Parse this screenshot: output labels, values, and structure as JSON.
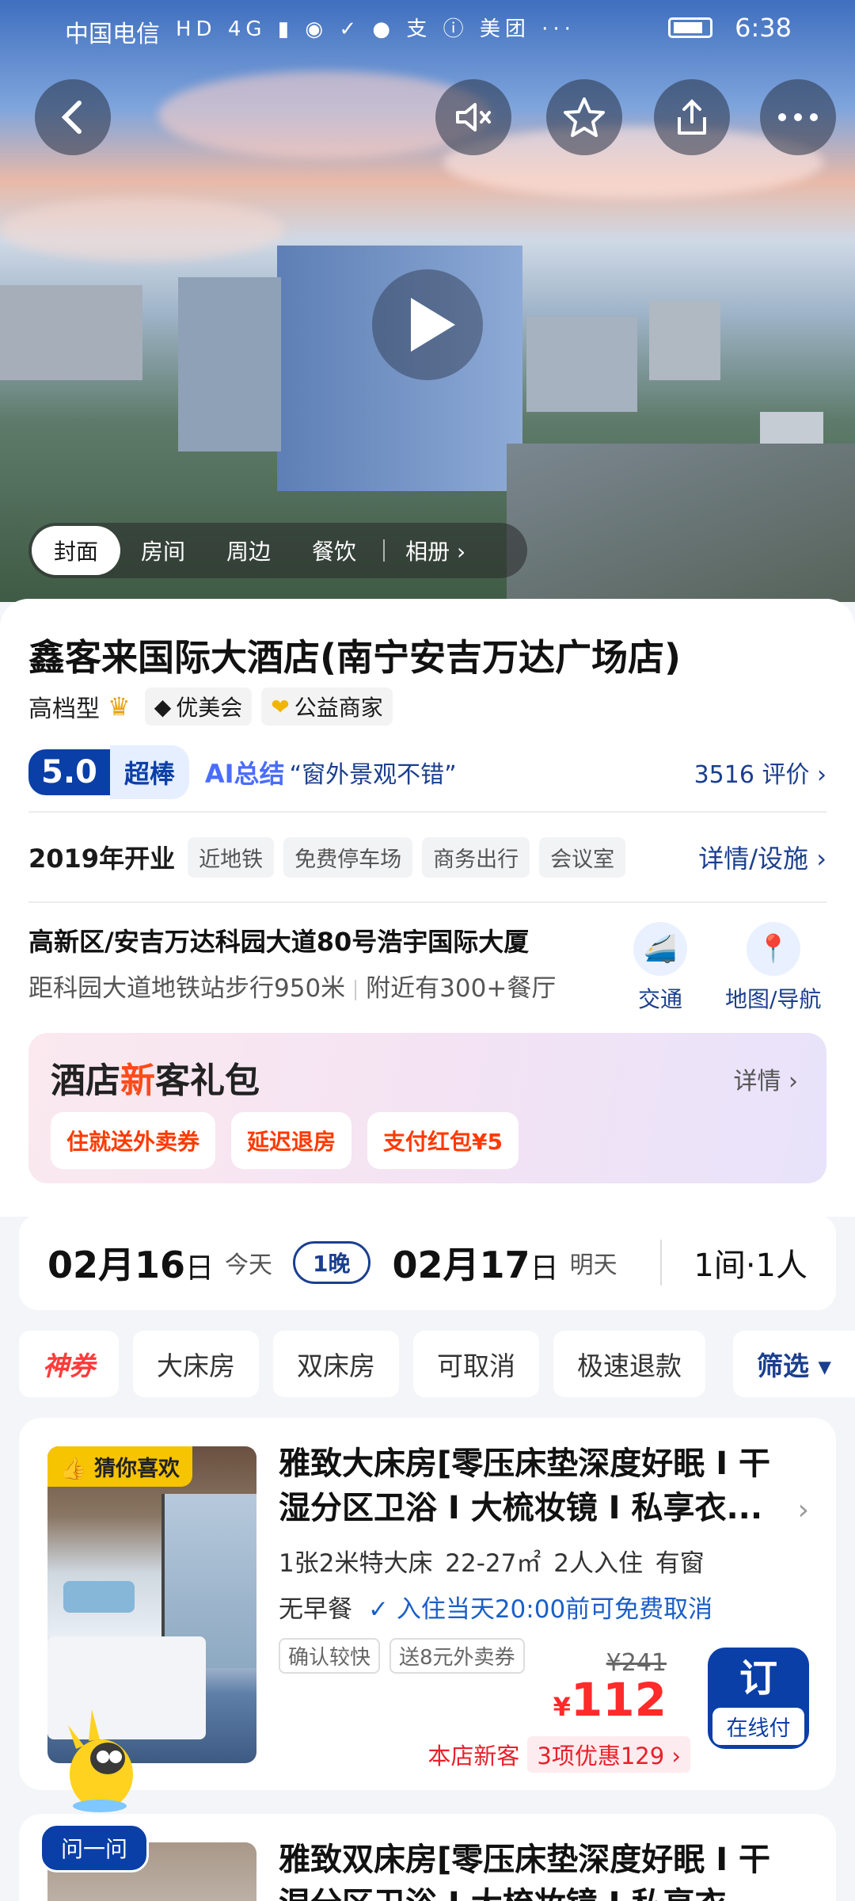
{
  "status_bar": {
    "carrier": "中国电信",
    "icons_text": "HD 4G ▮ ◉ ✓ ● 支 ⓘ 美团 ···",
    "time": "6:38"
  },
  "hero": {
    "buttons": [
      "back-icon",
      "mute-icon",
      "star-icon",
      "share-icon",
      "more-icon"
    ],
    "tabs": [
      "封面",
      "房间",
      "周边",
      "餐饮",
      "相册 ›"
    ]
  },
  "hotel": {
    "name": "鑫客来国际大酒店(南宁安吉万达广场店)",
    "level": "高档型",
    "chip1": "优美会",
    "chip2": "公益商家",
    "score": "5.0",
    "score_word": "超棒",
    "ai_label": "AI总结",
    "ai_quote": "“窗外景观不错”",
    "reviews": "3516 评价 ›",
    "opened": "2019年开业",
    "facilities": [
      "近地铁",
      "免费停车场",
      "商务出行",
      "会议室"
    ],
    "facilities_link": "详情/设施 ›",
    "address": "高新区/安吉万达科园大道80号浩宇国际大厦",
    "distance": "距科园大道地铁站步行950米",
    "nearby": "附近有300+餐厅",
    "traffic": "交通",
    "map_nav": "地图/导航"
  },
  "gift": {
    "title_a": "酒店",
    "title_new": "新",
    "title_b": "客礼包",
    "detail": "详情 ›",
    "chips": [
      "住就送外卖券",
      "延迟退房",
      "支付红包¥5"
    ]
  },
  "dates": {
    "checkin_num": "02月16",
    "checkin_day": "日",
    "checkin_label": "今天",
    "nights": "1晚",
    "checkout_num": "02月17",
    "checkout_day": "日",
    "checkout_label": "明天",
    "rooms": "1间·1人"
  },
  "filters": {
    "coupon": "神券",
    "items": [
      "大床房",
      "双床房",
      "可取消",
      "极速退款"
    ],
    "screen": "筛选 ▾"
  },
  "room1": {
    "badge": "👍 猜你喜欢",
    "title_line1": "雅致大床房[零压床垫深度好眠 I 干",
    "title_line2": "湿分区卫浴 I 大梳妆镜 I 私享衣...",
    "spec": "1张2米特大床  22-27㎡  2人入住  有窗",
    "meal": "无早餐",
    "cancel": "✓ 入住当天20:00前可免费取消",
    "tags": [
      "确认较快",
      "送8元外卖券"
    ],
    "old_price": "¥241",
    "price_symbol": "¥",
    "price": "112",
    "promo_label": "本店新客",
    "promo_box": "3项优惠129 ›",
    "book_big": "订",
    "book_small": "在线付"
  },
  "room2": {
    "title_line1": "雅致双床房[零压床垫深度好眠 I 干",
    "title_line2": "湿分区卫浴 I 大梳妆镜 I 私享衣..."
  },
  "assistant": {
    "label": "问一问"
  }
}
